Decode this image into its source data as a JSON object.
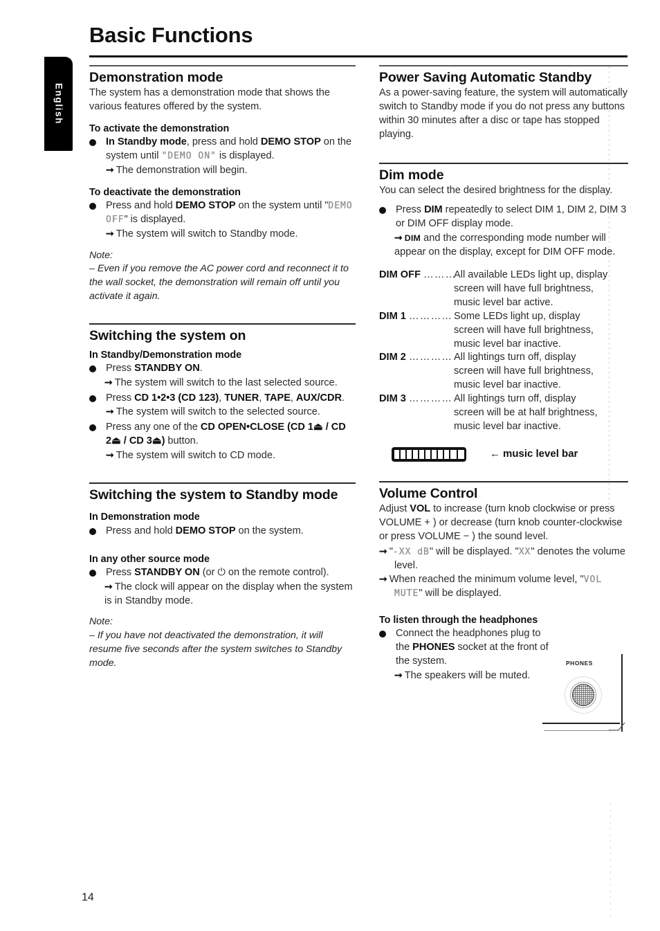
{
  "page": {
    "title": "Basic Functions",
    "language_tab": "English",
    "page_number": "14"
  },
  "left_column": {
    "demonstration": {
      "heading": "Demonstration mode",
      "intro": "The system has a demonstration mode that shows the various features offered by the system.",
      "activate": {
        "subheading": "To activate the demonstration",
        "bullet_pre": "In Standby mode",
        "bullet_mid": ", press and hold ",
        "bullet_bold": "DEMO STOP",
        "bullet_post": " on the system until ",
        "lcd": "\"DEMO ON\"",
        "bullet_end": " is displayed.",
        "arrow": "The demonstration will begin."
      },
      "deactivate": {
        "subheading": "To deactivate the demonstration",
        "bullet_pre": "Press and hold ",
        "bullet_bold": "DEMO STOP",
        "bullet_post": " on the system until \"",
        "lcd": "DEMO OFF",
        "bullet_end": "\" is displayed.",
        "arrow": "The system will switch to Standby mode."
      },
      "note_label": "Note:",
      "note_text": "–  Even if you remove the AC power cord and reconnect it to the wall socket, the demonstration will remain off until you activate it again."
    },
    "switching_on": {
      "heading": "Switching the system on",
      "subheading": "In Standby/Demonstration mode",
      "item1_pre": "Press ",
      "item1_bold": "STANDBY ON",
      "item1_post": ".",
      "item1_arrow": "The system will switch to the last selected source.",
      "item2_pre": "Press ",
      "item2_bold": "CD 1•2•3 (CD 123)",
      "item2_mid": ", ",
      "item2_bold2": "TUNER",
      "item2_mid2": ", ",
      "item2_bold3": "TAPE",
      "item2_mid3": ", ",
      "item2_bold4": "AUX/CDR",
      "item2_post": ".",
      "item2_arrow": "The system will switch to the selected source.",
      "item3_pre": "Press any one of the ",
      "item3_bold": "CD OPEN•CLOSE",
      "item3_bold2": "(CD 1⏏ / CD 2⏏ / CD 3⏏)",
      "item3_post": " button.",
      "item3_arrow": "The system will switch to CD mode."
    },
    "switching_standby": {
      "heading": "Switching the system to Standby mode",
      "sub1": "In Demonstration mode",
      "sub1_pre": "Press and hold ",
      "sub1_bold": "DEMO STOP",
      "sub1_post": " on the system.",
      "sub2": "In any other source mode",
      "sub2_pre": "Press ",
      "sub2_bold": "STANDBY ON",
      "sub2_mid": " (or ",
      "sub2_symbol": "⏻",
      "sub2_post": " on the remote control).",
      "sub2_arrow": "The clock will appear on the display when the system is in Standby mode.",
      "note_label": "Note:",
      "note_text": "–  If you have not deactivated the demonstration, it will resume five seconds after the system switches to Standby mode."
    }
  },
  "right_column": {
    "power_saving": {
      "heading": "Power Saving Automatic Standby",
      "body": "As a power-saving feature, the system will automatically switch to Standby mode if you do not press any buttons within 30 minutes after a disc or tape has stopped playing."
    },
    "dim_mode": {
      "heading": "Dim mode",
      "intro": "You can select the desired brightness for the display.",
      "bullet_pre": "Press ",
      "bullet_bold": "DIM",
      "bullet_post": " repeatedly to select DIM 1, DIM 2, DIM 3 or DIM OFF display mode.",
      "arrow_bold": "DIM",
      "arrow_rest": " and the corresponding mode number will appear on the display, except for DIM OFF mode.",
      "entries": [
        {
          "term": "DIM OFF",
          "leader": "………",
          "lines": [
            "All available LEDs light up, display",
            "screen will have full brightness,",
            "music level bar active."
          ]
        },
        {
          "term": "DIM 1",
          "leader": "…………",
          "lines": [
            "Some LEDs light up, display",
            "screen will have full brightness,",
            "music level bar inactive."
          ]
        },
        {
          "term": "DIM 2",
          "leader": "…………",
          "lines": [
            "All lightings turn off, display",
            "screen will have full brightness,",
            "music level bar inactive."
          ]
        },
        {
          "term": "DIM 3",
          "leader": "…………",
          "lines": [
            "All lightings turn off, display",
            "screen will be at half brightness,",
            "music level bar inactive."
          ]
        }
      ],
      "figure": {
        "arrow": "←",
        "caption": "music level bar",
        "segments": 11
      }
    },
    "volume_control": {
      "heading": "Volume Control",
      "body_pre": "Adjust ",
      "body_bold": "VOL",
      "body_post": " to increase (turn knob clockwise or press VOLUME  + ) or decrease (turn knob counter-clockwise or press VOLUME  − ) the sound level.",
      "arrow1_pre": "\"",
      "arrow1_lcd": "-XX dB",
      "arrow1_mid": "\" will be displayed.  \"",
      "arrow1_lcd2": "XX",
      "arrow1_post": "\" denotes the volume level.",
      "arrow2_pre": "When reached the minimum volume level, \"",
      "arrow2_lcd": "VOL MUTE",
      "arrow2_post": "\" will be displayed.",
      "headphones": {
        "subheading": "To listen through the headphones",
        "bullet_pre": "Connect the headphones plug to the ",
        "bullet_bold": "PHONES",
        "bullet_post": " socket at the front of the system.",
        "arrow": "The speakers will be muted.",
        "figure_label": "PHONES"
      }
    }
  }
}
